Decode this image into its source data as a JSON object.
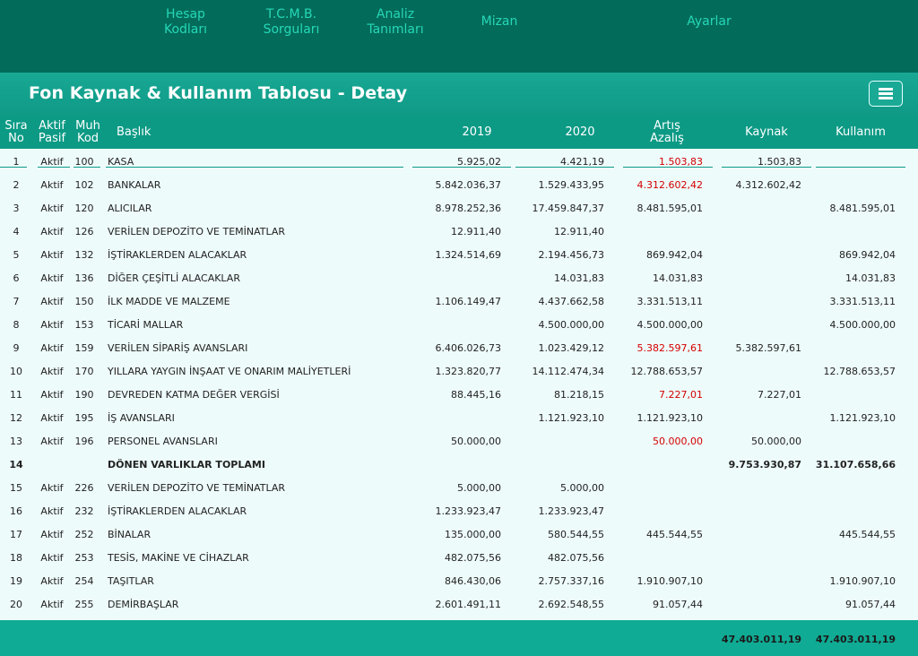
{
  "nav": {
    "items": [
      {
        "label": "Hesap\nKodları",
        "line1": "Hesap",
        "line2": "Kodları"
      },
      {
        "label": "T.C.M.B.\nSorguları",
        "line1": "T.C.M.B.",
        "line2": "Sorguları"
      },
      {
        "label": "Analiz\nTanımları",
        "line1": "Analiz",
        "line2": "Tanımları"
      },
      {
        "label": "Mizan"
      },
      {
        "label": "Ayarlar"
      }
    ]
  },
  "page": {
    "title": "Fon Kaynak & Kullanım Tablosu - Detay",
    "menu_icon": "hamburger-icon"
  },
  "table": {
    "headers": {
      "sira_1": "Sıra",
      "sira_2": "No",
      "aktif_1": "Aktif",
      "aktif_2": "Pasif",
      "muh_1": "Muh",
      "muh_2": "Kod",
      "baslik": "Başlık",
      "y2019": "2019",
      "y2020": "2020",
      "artis_1": "Artış",
      "artis_2": "Azalış",
      "kaynak": "Kaynak",
      "kullanim": "Kullanım"
    },
    "rows": [
      {
        "no": "1",
        "ap": "Aktif",
        "kod": "100",
        "baslik": "KASA",
        "y2019": "5.925,02",
        "y2020": "4.421,19",
        "artis": "1.503,83",
        "artis_red": true,
        "kaynak": "1.503,83",
        "kullanim": ""
      },
      {
        "no": "2",
        "ap": "Aktif",
        "kod": "102",
        "baslik": "BANKALAR",
        "y2019": "5.842.036,37",
        "y2020": "1.529.433,95",
        "artis": "4.312.602,42",
        "artis_red": true,
        "kaynak": "4.312.602,42",
        "kullanim": ""
      },
      {
        "no": "3",
        "ap": "Aktif",
        "kod": "120",
        "baslik": "ALICILAR",
        "y2019": "8.978.252,36",
        "y2020": "17.459.847,37",
        "artis": "8.481.595,01",
        "artis_red": false,
        "kaynak": "",
        "kullanim": "8.481.595,01"
      },
      {
        "no": "4",
        "ap": "Aktif",
        "kod": "126",
        "baslik": "VERİLEN DEPOZİTO VE TEMİNATLAR",
        "y2019": "12.911,40",
        "y2020": "12.911,40",
        "artis": "",
        "artis_red": false,
        "kaynak": "",
        "kullanim": ""
      },
      {
        "no": "5",
        "ap": "Aktif",
        "kod": "132",
        "baslik": "İŞTİRAKLERDEN ALACAKLAR",
        "y2019": "1.324.514,69",
        "y2020": "2.194.456,73",
        "artis": "869.942,04",
        "artis_red": false,
        "kaynak": "",
        "kullanim": "869.942,04"
      },
      {
        "no": "6",
        "ap": "Aktif",
        "kod": "136",
        "baslik": "DİĞER ÇEŞİTLİ ALACAKLAR",
        "y2019": "",
        "y2020": "14.031,83",
        "artis": "14.031,83",
        "artis_red": false,
        "kaynak": "",
        "kullanim": "14.031,83"
      },
      {
        "no": "7",
        "ap": "Aktif",
        "kod": "150",
        "baslik": "İLK MADDE VE MALZEME",
        "y2019": "1.106.149,47",
        "y2020": "4.437.662,58",
        "artis": "3.331.513,11",
        "artis_red": false,
        "kaynak": "",
        "kullanim": "3.331.513,11"
      },
      {
        "no": "8",
        "ap": "Aktif",
        "kod": "153",
        "baslik": "TİCARİ MALLAR",
        "y2019": "",
        "y2020": "4.500.000,00",
        "artis": "4.500.000,00",
        "artis_red": false,
        "kaynak": "",
        "kullanim": "4.500.000,00"
      },
      {
        "no": "9",
        "ap": "Aktif",
        "kod": "159",
        "baslik": "VERİLEN SİPARİŞ AVANSLARI",
        "y2019": "6.406.026,73",
        "y2020": "1.023.429,12",
        "artis": "5.382.597,61",
        "artis_red": true,
        "kaynak": "5.382.597,61",
        "kullanim": ""
      },
      {
        "no": "10",
        "ap": "Aktif",
        "kod": "170",
        "baslik": "YILLARA YAYGIN İNŞAAT VE ONARIM MALİYETLERİ",
        "y2019": "1.323.820,77",
        "y2020": "14.112.474,34",
        "artis": "12.788.653,57",
        "artis_red": false,
        "kaynak": "",
        "kullanim": "12.788.653,57"
      },
      {
        "no": "11",
        "ap": "Aktif",
        "kod": "190",
        "baslik": "DEVREDEN KATMA DEĞER VERGİSİ",
        "y2019": "88.445,16",
        "y2020": "81.218,15",
        "artis": "7.227,01",
        "artis_red": true,
        "kaynak": "7.227,01",
        "kullanim": ""
      },
      {
        "no": "12",
        "ap": "Aktif",
        "kod": "195",
        "baslik": "İŞ AVANSLARI",
        "y2019": "",
        "y2020": "1.121.923,10",
        "artis": "1.121.923,10",
        "artis_red": false,
        "kaynak": "",
        "kullanim": "1.121.923,10"
      },
      {
        "no": "13",
        "ap": "Aktif",
        "kod": "196",
        "baslik": "PERSONEL AVANSLARI",
        "y2019": "50.000,00",
        "y2020": "",
        "artis": "50.000,00",
        "artis_red": true,
        "kaynak": "50.000,00",
        "kullanim": ""
      },
      {
        "no": "14",
        "ap": "",
        "kod": "",
        "baslik": "DÖNEN VARLIKLAR TOPLAMI",
        "y2019": "",
        "y2020": "",
        "artis": "",
        "artis_red": false,
        "kaynak": "9.753.930,87",
        "kullanim": "31.107.658,66",
        "bold": true
      },
      {
        "no": "15",
        "ap": "Aktif",
        "kod": "226",
        "baslik": "VERİLEN DEPOZİTO VE TEMİNATLAR",
        "y2019": "5.000,00",
        "y2020": "5.000,00",
        "artis": "",
        "artis_red": false,
        "kaynak": "",
        "kullanim": ""
      },
      {
        "no": "16",
        "ap": "Aktif",
        "kod": "232",
        "baslik": "İŞTİRAKLERDEN ALACAKLAR",
        "y2019": "1.233.923,47",
        "y2020": "1.233.923,47",
        "artis": "",
        "artis_red": false,
        "kaynak": "",
        "kullanim": ""
      },
      {
        "no": "17",
        "ap": "Aktif",
        "kod": "252",
        "baslik": "BİNALAR",
        "y2019": "135.000,00",
        "y2020": "580.544,55",
        "artis": "445.544,55",
        "artis_red": false,
        "kaynak": "",
        "kullanim": "445.544,55"
      },
      {
        "no": "18",
        "ap": "Aktif",
        "kod": "253",
        "baslik": "TESİS, MAKİNE VE CİHAZLAR",
        "y2019": "482.075,56",
        "y2020": "482.075,56",
        "artis": "",
        "artis_red": false,
        "kaynak": "",
        "kullanim": ""
      },
      {
        "no": "19",
        "ap": "Aktif",
        "kod": "254",
        "baslik": "TAŞITLAR",
        "y2019": "846.430,06",
        "y2020": "2.757.337,16",
        "artis": "1.910.907,10",
        "artis_red": false,
        "kaynak": "",
        "kullanim": "1.910.907,10"
      },
      {
        "no": "20",
        "ap": "Aktif",
        "kod": "255",
        "baslik": "DEMİRBAŞLAR",
        "y2019": "2.601.491,11",
        "y2020": "2.692.548,55",
        "artis": "91.057,44",
        "artis_red": false,
        "kaynak": "",
        "kullanim": "91.057,44"
      }
    ]
  },
  "footer": {
    "kaynak_total": "47.403.011,19",
    "kullanim_total": "47.403.011,19"
  },
  "colors": {
    "nav_bg": "#036b5a",
    "nav_text": "#25d8b7",
    "title_bg": "#18a894",
    "header_bg": "#0c9a85",
    "body_bg": "#eefbfb",
    "negative": "#d40000"
  }
}
